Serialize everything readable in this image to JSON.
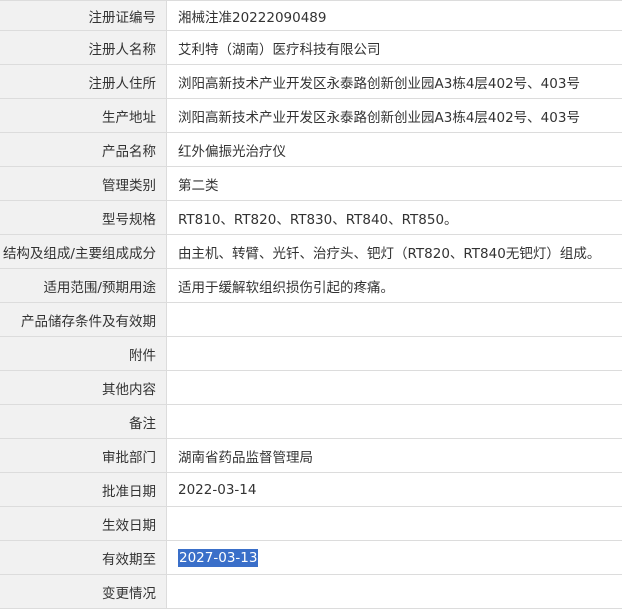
{
  "rows": [
    {
      "label": "注册证编号",
      "value": "湘械注准20222090489"
    },
    {
      "label": "注册人名称",
      "value": "艾利特（湖南）医疗科技有限公司"
    },
    {
      "label": "注册人住所",
      "value": "浏阳高新技术产业开发区永泰路创新创业园A3栋4层402号、403号"
    },
    {
      "label": "生产地址",
      "value": "浏阳高新技术产业开发区永泰路创新创业园A3栋4层402号、403号"
    },
    {
      "label": "产品名称",
      "value": "红外偏振光治疗仪"
    },
    {
      "label": "管理类别",
      "value": "第二类"
    },
    {
      "label": "型号规格",
      "value": "RT810、RT820、RT830、RT840、RT850。"
    },
    {
      "label": "结构及组成/主要组成成分",
      "value": "由主机、转臂、光钎、治疗头、钯灯（RT820、RT840无钯灯）组成。"
    },
    {
      "label": "适用范围/预期用途",
      "value": "适用于缓解软组织损伤引起的疼痛。"
    },
    {
      "label": "产品储存条件及有效期",
      "value": ""
    },
    {
      "label": "附件",
      "value": ""
    },
    {
      "label": "其他内容",
      "value": ""
    },
    {
      "label": "备注",
      "value": ""
    },
    {
      "label": "审批部门",
      "value": "湖南省药品监督管理局"
    },
    {
      "label": "批准日期",
      "value": "2022-03-14"
    },
    {
      "label": "生效日期",
      "value": ""
    },
    {
      "label": "有效期至",
      "value": "2027-03-13",
      "selected": true
    },
    {
      "label": "变更情况",
      "value": ""
    }
  ]
}
